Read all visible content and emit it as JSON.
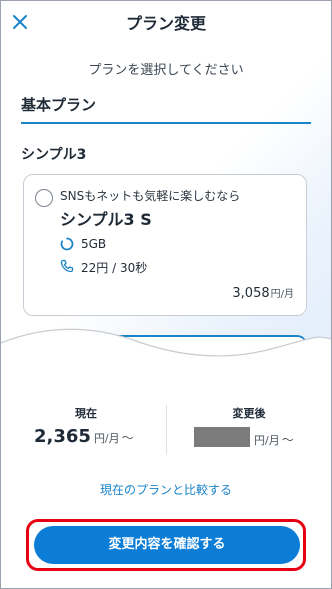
{
  "header": {
    "title": "プラン変更",
    "close_icon": "close-icon"
  },
  "subtitle": "プランを選択してください",
  "plan_field": {
    "value": "基本プラン"
  },
  "section": {
    "label": "シンプル3"
  },
  "plan_card": {
    "description": "SNSもネットも気軽に楽しむなら",
    "name": "シンプル3 S",
    "data_amount": "5GB",
    "call_rate": "22円 / 30秒",
    "price": "3,058",
    "price_unit": "円/月",
    "selected": false
  },
  "summary": {
    "current_label": "現在",
    "current_price": "2,365",
    "current_unit": "円/月",
    "current_suffix": "〜",
    "after_label": "変更後",
    "after_unit": "円/月",
    "after_suffix": "〜"
  },
  "compare_link": "現在のプランと比較する",
  "confirm_button": "変更内容を確認する",
  "colors": {
    "accent": "#1a84c9",
    "button": "#0b7dd6",
    "highlight": "#e60012",
    "masked": "#7b7b7b"
  }
}
